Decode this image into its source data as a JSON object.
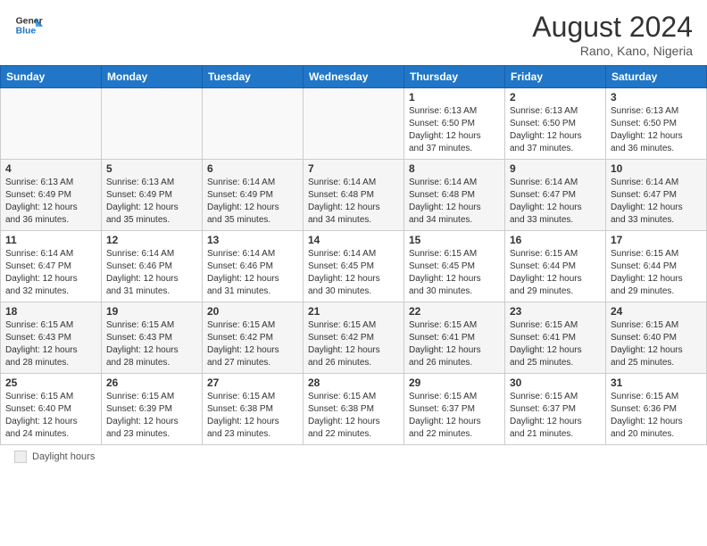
{
  "header": {
    "logo_general": "General",
    "logo_blue": "Blue",
    "month_title": "August 2024",
    "location": "Rano, Kano, Nigeria"
  },
  "days_of_week": [
    "Sunday",
    "Monday",
    "Tuesday",
    "Wednesday",
    "Thursday",
    "Friday",
    "Saturday"
  ],
  "footer": {
    "label": "Daylight hours"
  },
  "weeks": [
    [
      {
        "day": "",
        "info": ""
      },
      {
        "day": "",
        "info": ""
      },
      {
        "day": "",
        "info": ""
      },
      {
        "day": "",
        "info": ""
      },
      {
        "day": "1",
        "info": "Sunrise: 6:13 AM\nSunset: 6:50 PM\nDaylight: 12 hours\nand 37 minutes."
      },
      {
        "day": "2",
        "info": "Sunrise: 6:13 AM\nSunset: 6:50 PM\nDaylight: 12 hours\nand 37 minutes."
      },
      {
        "day": "3",
        "info": "Sunrise: 6:13 AM\nSunset: 6:50 PM\nDaylight: 12 hours\nand 36 minutes."
      }
    ],
    [
      {
        "day": "4",
        "info": "Sunrise: 6:13 AM\nSunset: 6:49 PM\nDaylight: 12 hours\nand 36 minutes."
      },
      {
        "day": "5",
        "info": "Sunrise: 6:13 AM\nSunset: 6:49 PM\nDaylight: 12 hours\nand 35 minutes."
      },
      {
        "day": "6",
        "info": "Sunrise: 6:14 AM\nSunset: 6:49 PM\nDaylight: 12 hours\nand 35 minutes."
      },
      {
        "day": "7",
        "info": "Sunrise: 6:14 AM\nSunset: 6:48 PM\nDaylight: 12 hours\nand 34 minutes."
      },
      {
        "day": "8",
        "info": "Sunrise: 6:14 AM\nSunset: 6:48 PM\nDaylight: 12 hours\nand 34 minutes."
      },
      {
        "day": "9",
        "info": "Sunrise: 6:14 AM\nSunset: 6:47 PM\nDaylight: 12 hours\nand 33 minutes."
      },
      {
        "day": "10",
        "info": "Sunrise: 6:14 AM\nSunset: 6:47 PM\nDaylight: 12 hours\nand 33 minutes."
      }
    ],
    [
      {
        "day": "11",
        "info": "Sunrise: 6:14 AM\nSunset: 6:47 PM\nDaylight: 12 hours\nand 32 minutes."
      },
      {
        "day": "12",
        "info": "Sunrise: 6:14 AM\nSunset: 6:46 PM\nDaylight: 12 hours\nand 31 minutes."
      },
      {
        "day": "13",
        "info": "Sunrise: 6:14 AM\nSunset: 6:46 PM\nDaylight: 12 hours\nand 31 minutes."
      },
      {
        "day": "14",
        "info": "Sunrise: 6:14 AM\nSunset: 6:45 PM\nDaylight: 12 hours\nand 30 minutes."
      },
      {
        "day": "15",
        "info": "Sunrise: 6:15 AM\nSunset: 6:45 PM\nDaylight: 12 hours\nand 30 minutes."
      },
      {
        "day": "16",
        "info": "Sunrise: 6:15 AM\nSunset: 6:44 PM\nDaylight: 12 hours\nand 29 minutes."
      },
      {
        "day": "17",
        "info": "Sunrise: 6:15 AM\nSunset: 6:44 PM\nDaylight: 12 hours\nand 29 minutes."
      }
    ],
    [
      {
        "day": "18",
        "info": "Sunrise: 6:15 AM\nSunset: 6:43 PM\nDaylight: 12 hours\nand 28 minutes."
      },
      {
        "day": "19",
        "info": "Sunrise: 6:15 AM\nSunset: 6:43 PM\nDaylight: 12 hours\nand 28 minutes."
      },
      {
        "day": "20",
        "info": "Sunrise: 6:15 AM\nSunset: 6:42 PM\nDaylight: 12 hours\nand 27 minutes."
      },
      {
        "day": "21",
        "info": "Sunrise: 6:15 AM\nSunset: 6:42 PM\nDaylight: 12 hours\nand 26 minutes."
      },
      {
        "day": "22",
        "info": "Sunrise: 6:15 AM\nSunset: 6:41 PM\nDaylight: 12 hours\nand 26 minutes."
      },
      {
        "day": "23",
        "info": "Sunrise: 6:15 AM\nSunset: 6:41 PM\nDaylight: 12 hours\nand 25 minutes."
      },
      {
        "day": "24",
        "info": "Sunrise: 6:15 AM\nSunset: 6:40 PM\nDaylight: 12 hours\nand 25 minutes."
      }
    ],
    [
      {
        "day": "25",
        "info": "Sunrise: 6:15 AM\nSunset: 6:40 PM\nDaylight: 12 hours\nand 24 minutes."
      },
      {
        "day": "26",
        "info": "Sunrise: 6:15 AM\nSunset: 6:39 PM\nDaylight: 12 hours\nand 23 minutes."
      },
      {
        "day": "27",
        "info": "Sunrise: 6:15 AM\nSunset: 6:38 PM\nDaylight: 12 hours\nand 23 minutes."
      },
      {
        "day": "28",
        "info": "Sunrise: 6:15 AM\nSunset: 6:38 PM\nDaylight: 12 hours\nand 22 minutes."
      },
      {
        "day": "29",
        "info": "Sunrise: 6:15 AM\nSunset: 6:37 PM\nDaylight: 12 hours\nand 22 minutes."
      },
      {
        "day": "30",
        "info": "Sunrise: 6:15 AM\nSunset: 6:37 PM\nDaylight: 12 hours\nand 21 minutes."
      },
      {
        "day": "31",
        "info": "Sunrise: 6:15 AM\nSunset: 6:36 PM\nDaylight: 12 hours\nand 20 minutes."
      }
    ]
  ]
}
